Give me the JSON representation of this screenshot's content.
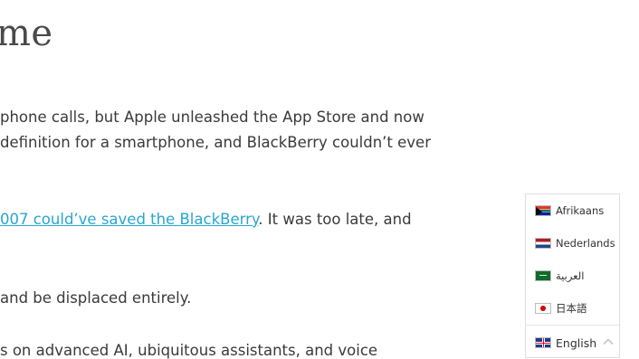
{
  "article": {
    "title": "me",
    "line1": "phone calls, but Apple unleashed the App Store and now",
    "line2": "definition for a smartphone, and BlackBerry couldn’t ever",
    "line3_link": "007 could’ve saved the BlackBerry",
    "line3_text": ". It was too late, and",
    "line4": " and be displaced entirely.",
    "line5": "s on advanced AI, ubiquitous assistants, and voice"
  },
  "language_switcher": {
    "options": [
      {
        "label": "Afrikaans",
        "flag": "south-africa-flag-icon"
      },
      {
        "label": "Nederlands",
        "flag": "netherlands-flag-icon"
      },
      {
        "label": "العربية",
        "flag": "saudi-arabia-flag-icon"
      },
      {
        "label": "日本語",
        "flag": "japan-flag-icon"
      }
    ],
    "current": {
      "label": "English",
      "flag": "united-kingdom-flag-icon"
    },
    "toggle_icon": "chevron-up-icon"
  },
  "colors": {
    "link": "#29a6d2",
    "text": "#3a3a3a",
    "panel_border": "#dedede"
  }
}
